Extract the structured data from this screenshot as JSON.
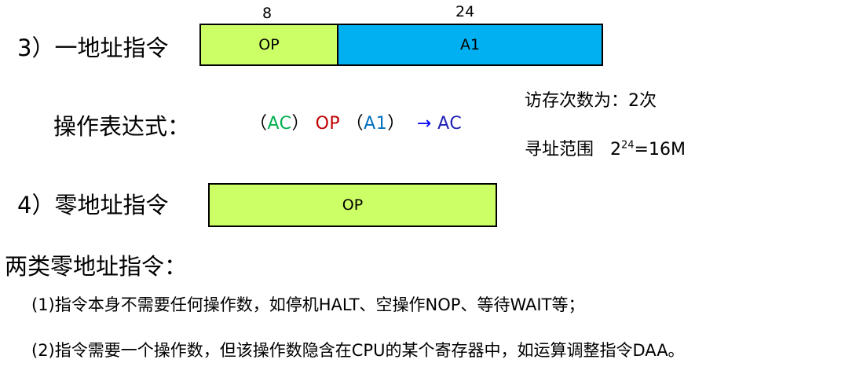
{
  "section3": {
    "title": "3）一地址指令",
    "bit_op": "8",
    "bit_addr": "24",
    "op_label": "OP",
    "addr_label": "A1"
  },
  "expression": {
    "label": "操作表达式：",
    "open1": "（",
    "ac1": "AC",
    "close1": "）",
    "op": "OP",
    "open2": "（",
    "a1": "A1",
    "close2": "）",
    "arrow": "→",
    "ac2": "AC"
  },
  "access": {
    "text": "访存次数为：2次"
  },
  "addressing": {
    "label": "寻址范围",
    "base": "2",
    "exponent": "24",
    "result": "=16M"
  },
  "section4": {
    "title": "4）零地址指令",
    "op_label": "OP"
  },
  "two_types": {
    "heading": "两类零地址指令：",
    "item1": "(1)指令本身不需要任何操作数，如停机HALT、空操作NOP、等待WAIT等；",
    "item2": "(2)指令需要一个操作数，但该操作数隐含在CPU的某个寄存器中，如运算调整指令DAA。"
  },
  "colors": {
    "op_box": "#ccff66",
    "addr_box": "#00b0f0",
    "ac_green": "#00b050",
    "op_red": "#c00000",
    "a1_blue": "#0070c0",
    "arrow_blue": "#0000ff"
  }
}
